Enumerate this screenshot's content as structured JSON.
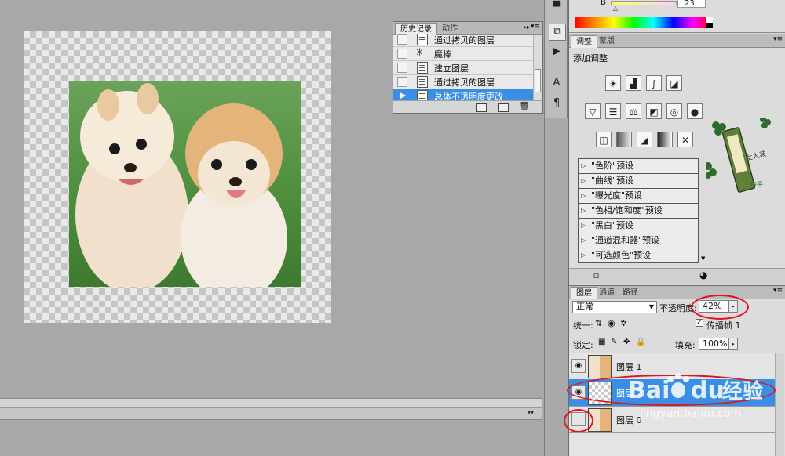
{
  "history_panel": {
    "tabs": [
      "历史记录",
      "动作"
    ],
    "items": [
      {
        "label": "通过拷贝的图层",
        "selected": false
      },
      {
        "label": "魔棒",
        "selected": false
      },
      {
        "label": "建立图层",
        "selected": false
      },
      {
        "label": "通过拷贝的图层",
        "selected": false
      },
      {
        "label": "总体不透明度更改",
        "selected": true
      }
    ]
  },
  "color_panel": {
    "channel_label": "B",
    "channel_value": "23"
  },
  "adjust_panel": {
    "tabs": [
      "调整",
      "蒙版"
    ],
    "heading": "添加调整",
    "presets": [
      "\"色阶\"预设",
      "\"曲线\"预设",
      "\"曝光度\"预设",
      "\"色相/饱和度\"预设",
      "\"黑白\"预设",
      "\"通道混和器\"预设",
      "\"可选颜色\"预设"
    ]
  },
  "layers_panel": {
    "tabs": [
      "图层",
      "通道",
      "路径"
    ],
    "blend_mode": "正常",
    "opacity_label": "不透明度:",
    "opacity_value": "42%",
    "unify_label": "统一:",
    "propagate_label": "传播帧 1",
    "lock_label": "锁定:",
    "fill_label": "填充:",
    "fill_value": "100%",
    "layers": [
      {
        "name": "图层 1",
        "visible": true,
        "selected": false
      },
      {
        "name": "图层 2",
        "visible": true,
        "selected": true
      },
      {
        "name": "图层 0",
        "visible": false,
        "selected": false
      }
    ]
  },
  "decoration": {
    "text": "女人装",
    "subtext": "中平"
  },
  "watermark": {
    "brand_a": "Bai",
    "brand_b": "du",
    "brand_c": "经验",
    "url": "jingyan.baidu.com"
  },
  "colors": {
    "selection": "#3a8ee6",
    "annotation": "#e0141e"
  }
}
